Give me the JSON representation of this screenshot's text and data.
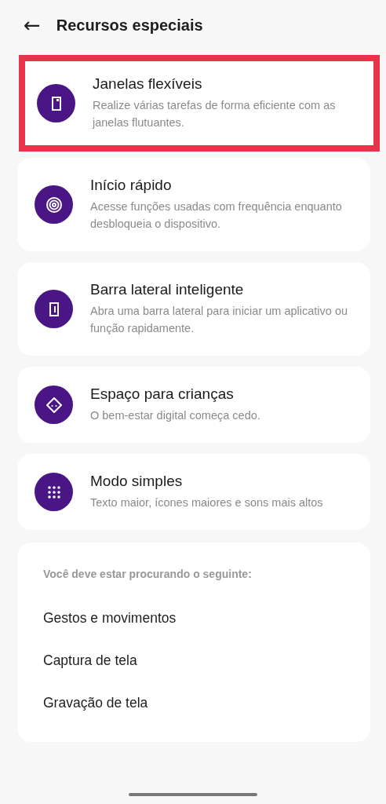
{
  "header": {
    "back": "←",
    "title": "Recursos especiais"
  },
  "features": [
    {
      "title": "Janelas flexíveis",
      "description": "Realize várias tarefas de forma eficiente com as janelas flutuantes.",
      "highlighted": true
    },
    {
      "title": "Início rápido",
      "description": "Acesse funções usadas com frequência enquanto desbloqueia o dispositivo.",
      "highlighted": false
    },
    {
      "title": "Barra lateral inteligente",
      "description": "Abra uma barra lateral para iniciar um aplicativo ou função rapidamente.",
      "highlighted": false
    },
    {
      "title": "Espaço para crianças",
      "description": "O bem-estar digital começa cedo.",
      "highlighted": false
    },
    {
      "title": "Modo simples",
      "description": "Texto maior, ícones maiores e sons mais altos",
      "highlighted": false
    }
  ],
  "suggestions": {
    "heading": "Você deve estar procurando o seguinte:",
    "items": [
      "Gestos e movimentos",
      "Captura de tela",
      "Gravação de tela"
    ]
  }
}
